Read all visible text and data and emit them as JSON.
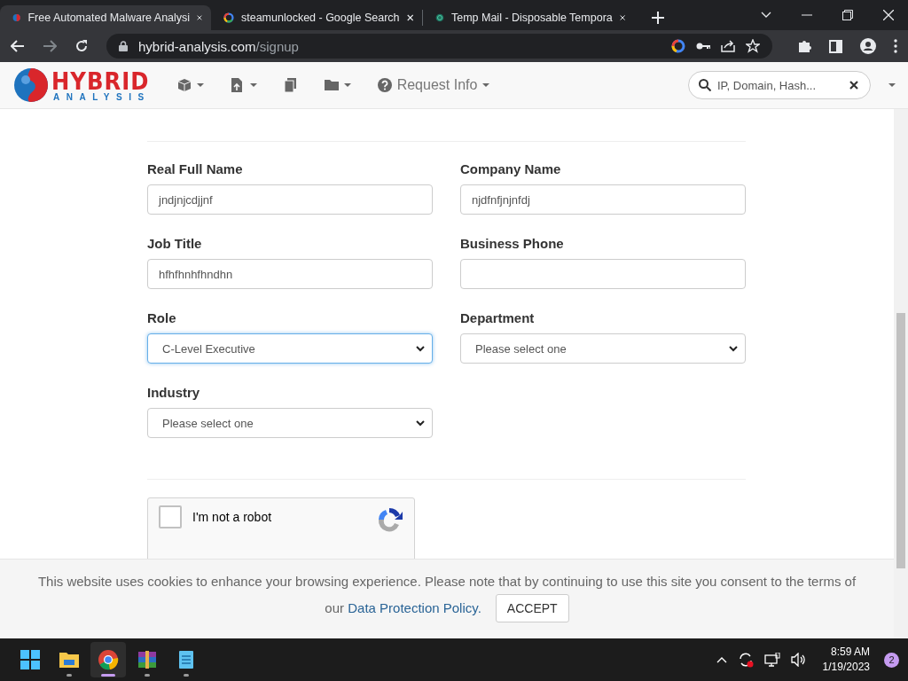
{
  "tabs": [
    {
      "title": "Free Automated Malware Analysi",
      "kind": "hybrid",
      "selected": true
    },
    {
      "title": "steamunlocked - Google Search",
      "kind": "google",
      "selected": false
    },
    {
      "title": "Temp Mail - Disposable Tempora",
      "kind": "tempmail",
      "selected": false
    }
  ],
  "address": {
    "host": "hybrid-analysis.com",
    "path": "/signup"
  },
  "site_nav": {
    "logo_top": "HYBRID",
    "logo_bottom": "ANALYSIS",
    "menu": [
      {
        "kind": "cube",
        "dropdown": true
      },
      {
        "kind": "upload",
        "dropdown": true
      },
      {
        "kind": "copy",
        "dropdown": false
      },
      {
        "kind": "folder",
        "dropdown": true
      },
      {
        "kind": "help",
        "label": "Request Info",
        "dropdown": true
      }
    ],
    "search": {
      "placeholder": "IP, Domain, Hash..."
    }
  },
  "form": {
    "fields": [
      {
        "label": "Real Full Name",
        "kind": "input",
        "value": "jndjnjcdjjnf",
        "focused": false
      },
      {
        "label": "Company Name",
        "kind": "input",
        "value": "njdfnfjnjnfdj",
        "focused": false
      },
      {
        "label": "Job Title",
        "kind": "input",
        "value": "hfhfhnhfhndhn",
        "focused": false
      },
      {
        "label": "Business Phone",
        "kind": "input",
        "focused": false
      },
      {
        "label": "Role",
        "kind": "select",
        "value": "C-Level Executive",
        "focused": true
      },
      {
        "label": "Department",
        "kind": "select",
        "value": "Please select one",
        "focused": false
      },
      {
        "label": "Industry",
        "kind": "select",
        "value": "Please select one",
        "focused": false
      }
    ],
    "recaptcha": {
      "label": "I'm not a robot",
      "checked": false
    }
  },
  "cookie_banner": {
    "text": "This website uses cookies to enhance your browsing experience. Please note that by continuing to use this site you consent to the terms of our",
    "link": "Data Protection Policy.",
    "button": "ACCEPT"
  },
  "taskbar": {
    "apps": [
      {
        "kind": "start",
        "running": false,
        "selected": false
      },
      {
        "kind": "explorer",
        "running": true,
        "selected": false
      },
      {
        "kind": "chrome",
        "running": true,
        "selected": true
      },
      {
        "kind": "winrar",
        "running": true,
        "selected": false
      },
      {
        "kind": "notepad",
        "running": true,
        "selected": false
      }
    ],
    "time": "8:59 AM",
    "date": "1/19/2023",
    "notifications": "2"
  }
}
